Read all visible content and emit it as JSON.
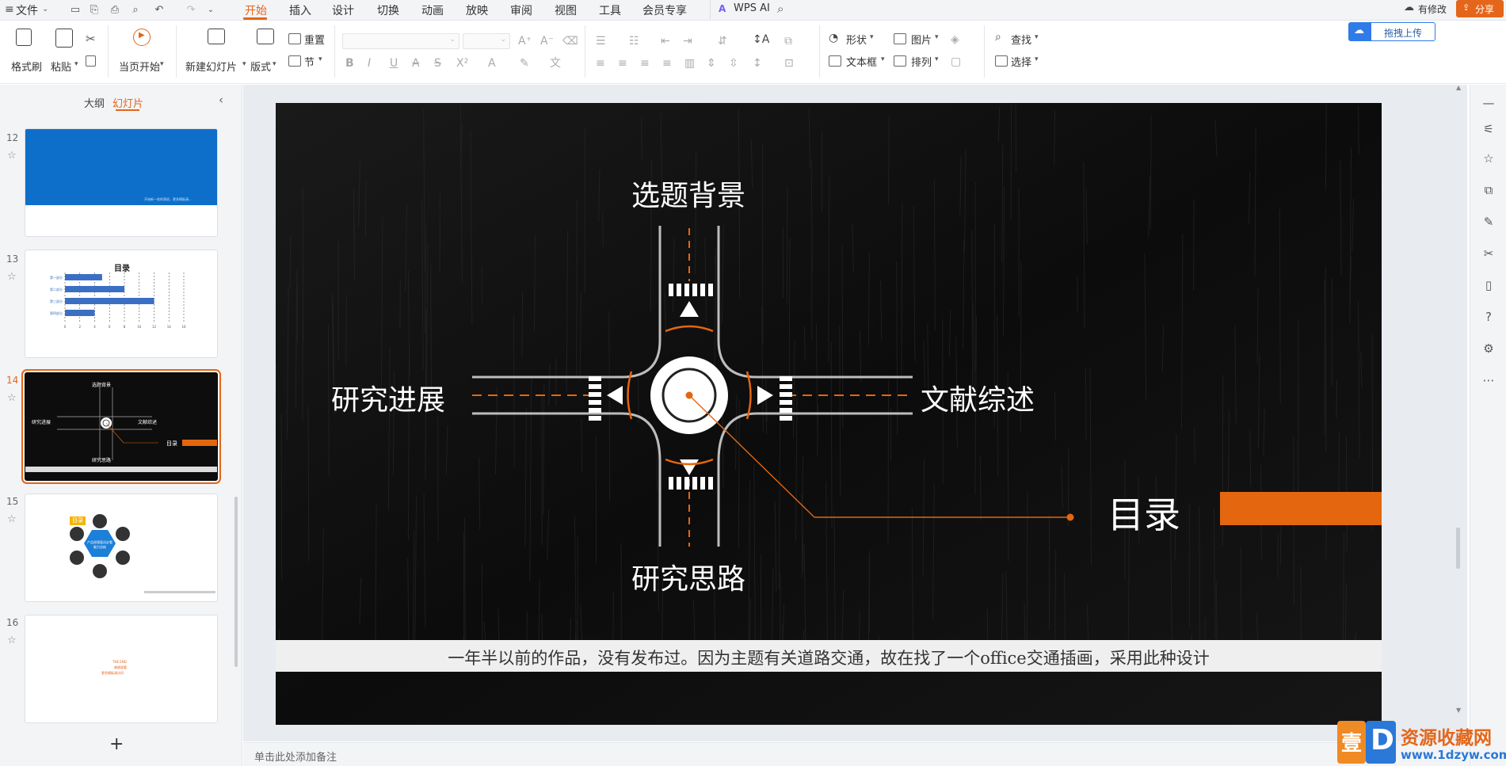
{
  "menu": {
    "file": "文件",
    "tabs": [
      "开始",
      "插入",
      "设计",
      "切换",
      "动画",
      "放映",
      "审阅",
      "视图",
      "工具",
      "会员专享"
    ],
    "active_tab": "开始",
    "ai": "WPS AI",
    "modified": "有修改",
    "share": "分享"
  },
  "ribbon": {
    "format_painter": "格式刷",
    "paste": "粘贴",
    "play_from_current": "当页开始",
    "new_slide": "新建幻灯片",
    "layout": "版式",
    "reset": "重置",
    "section": "节",
    "shape": "形状",
    "picture": "图片",
    "textbox": "文本框",
    "arrange": "排列",
    "find": "查找",
    "select": "选择",
    "upload": "拖拽上传"
  },
  "panel": {
    "tab_outline": "大纲",
    "tab_slides": "幻灯片",
    "slides": [
      {
        "num": "12",
        "caption": "开始新一轮的演说，更多模板请..."
      },
      {
        "num": "13",
        "title": "目录",
        "bars": [
          5,
          8,
          12,
          4
        ],
        "labels": [
          "第一部分",
          "第二部分",
          "第三部分",
          "第四部分"
        ],
        "axis": [
          "0",
          "2",
          "4",
          "6",
          "8",
          "10",
          "12",
          "14",
          "16"
        ]
      },
      {
        "num": "14",
        "labels": [
          "选题背景",
          "研究进展",
          "文献综述",
          "研究思路",
          "目录"
        ]
      },
      {
        "num": "15",
        "badge": "目录",
        "hex_text": "产品经理面试必看能力总结"
      },
      {
        "num": "16",
        "lines": [
          "THE END",
          "感谢观看",
          "更多模板请访问"
        ]
      }
    ],
    "add": "+"
  },
  "slide": {
    "labels": {
      "top": "选题背景",
      "left": "研究进展",
      "right": "文献综述",
      "bottom": "研究思路",
      "catalog": "目录"
    },
    "caption": "一年半以前的作品，没有发布过。因为主题有关道路交通，故在找了一个office交通插画，采用此种设计",
    "accent_color": "#e4660f"
  },
  "status": {
    "notes_placeholder": "单击此处添加备注"
  },
  "watermark": {
    "name": "资源收藏网",
    "url": "www.1dzyw.com"
  }
}
